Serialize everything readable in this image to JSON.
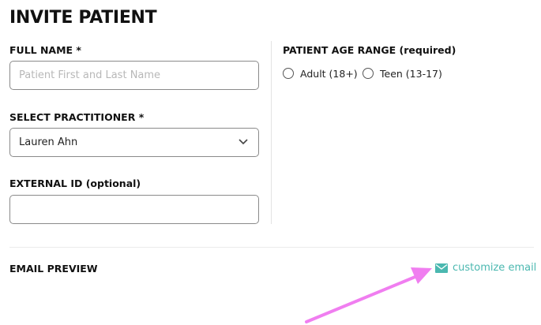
{
  "page": {
    "title": "INVITE PATIENT"
  },
  "form": {
    "full_name": {
      "label": "FULL NAME *",
      "placeholder": "Patient First and Last Name",
      "value": ""
    },
    "practitioner": {
      "label": "SELECT PRACTITIONER *",
      "selected": "Lauren Ahn"
    },
    "external_id": {
      "label": "EXTERNAL ID (optional)",
      "value": ""
    },
    "age_range": {
      "label": "PATIENT AGE RANGE (required)",
      "options": [
        "Adult (18+)",
        "Teen (13-17)"
      ]
    }
  },
  "email_preview": {
    "label": "EMAIL PREVIEW",
    "customize_label": "customize email"
  },
  "colors": {
    "accent": "#4bb8b0",
    "annotation_arrow": "#f07ef0"
  },
  "icons": {
    "select": "chevron-down-icon",
    "customize": "envelope-icon"
  }
}
